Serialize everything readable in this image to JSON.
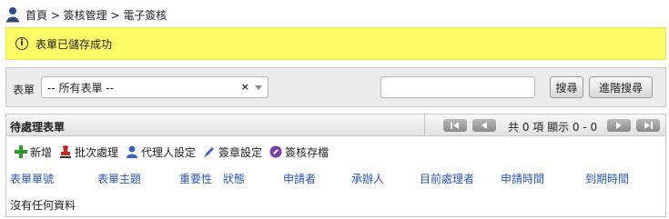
{
  "breadcrumb": {
    "text": "首頁 > 簽核管理 > 電子簽核",
    "icon": "user-icon"
  },
  "alert": {
    "message": "表單已儲存成功",
    "icon": "info-icon"
  },
  "search": {
    "form_label": "表單",
    "form_select_value": "-- 所有表單 --",
    "keyword_value": "",
    "search_button": "搜尋",
    "advanced_button": "進階搜尋"
  },
  "grid": {
    "title": "待處理表單",
    "pagination": {
      "text": "共 0 項 顯示 0 - 0"
    }
  },
  "toolbar": {
    "add": "新增",
    "batch": "批次處理",
    "proxy": "代理人設定",
    "signature": "簽章設定",
    "archive": "簽核存檔"
  },
  "columns": [
    "表單單號",
    "表單主題",
    "重要性",
    "狀態",
    "申請者",
    "承辦人",
    "目前處理者",
    "申請時間",
    "到期時間"
  ],
  "empty_text": "沒有任何資料",
  "colors": {
    "alert_bg": "#fcfc66",
    "link": "#2756b3",
    "add_green": "#2e9a2e",
    "batch_red": "#c62828",
    "proxy_blue": "#3a63c4",
    "archive_purple": "#7a3fa8"
  }
}
